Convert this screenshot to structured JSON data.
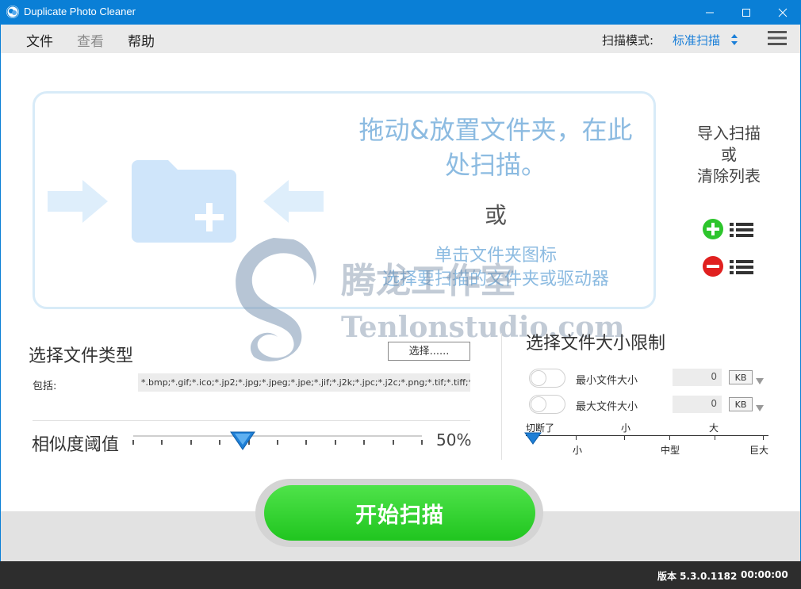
{
  "window": {
    "title": "Duplicate Photo Cleaner"
  },
  "menu": {
    "file": "文件",
    "view": "查看",
    "help": "帮助"
  },
  "scan_mode": {
    "label": "扫描模式:",
    "value": "标准扫描"
  },
  "dropzone": {
    "line1": "拖动&放置文件夹，在此",
    "line2": "处扫描。",
    "or": "或",
    "hint1": "单击文件夹图标",
    "hint2": "选择要扫描的文件夹或驱动器"
  },
  "import_panel": {
    "line1": "导入扫描",
    "line2": "或",
    "line3": "清除列表"
  },
  "watermark": {
    "cn": "腾龙工作室",
    "en": "Tenlonstudio.com"
  },
  "file_types": {
    "title": "选择文件类型",
    "select_button": "选择......",
    "include_label": "包括:",
    "include_value": "*.bmp;*.gif;*.ico;*.jp2;*.jpg;*.jpeg;*.jpe;*.jif;*.j2k;*.jpc;*.j2c;*.png;*.tif;*.tiff;*.tga;*.w"
  },
  "similarity": {
    "label": "相似度阈值",
    "value": "50%",
    "fraction": 0.5
  },
  "size_limit": {
    "title": "选择文件大小限制",
    "min_label": "最小文件大小",
    "min_value": "0",
    "max_label": "最大文件大小",
    "max_value": "0",
    "unit": "KB",
    "scale_top": [
      "切断了",
      "小",
      "大"
    ],
    "scale_bottom": [
      "小",
      "中型",
      "巨大"
    ]
  },
  "scan_button": "开始扫描",
  "status": {
    "version": "版本 5.3.0.1182",
    "timer": "00:00:00"
  },
  "colors": {
    "accent": "#0a7fd6",
    "green": "#2bd12a",
    "dropzone_text": "#8cbbe1"
  }
}
